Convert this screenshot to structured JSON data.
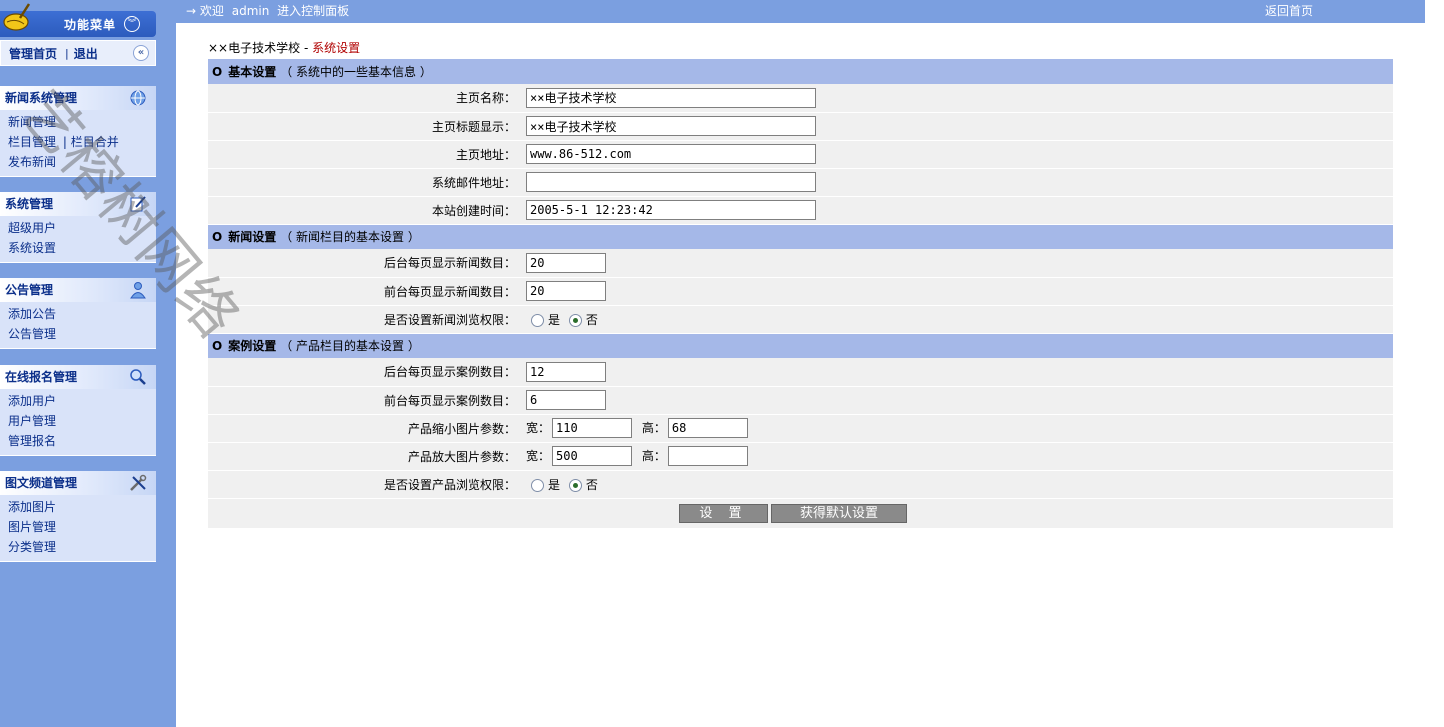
{
  "sidebar": {
    "menu_title": "功能菜单",
    "home_link": "管理首页",
    "separator": "|",
    "logout_link": "退出",
    "groups": [
      {
        "title": "新闻系统管理",
        "icon": "globe-icon",
        "items": [
          "新闻管理",
          "栏目管理",
          "发布新闻"
        ],
        "item2_extra": "栏目合并"
      },
      {
        "title": "系统管理",
        "icon": "edit-icon",
        "items": [
          "超级用户",
          "系统设置"
        ]
      },
      {
        "title": "公告管理",
        "icon": "user-icon",
        "items": [
          "添加公告",
          "公告管理"
        ]
      },
      {
        "title": "在线报名管理",
        "icon": "search-icon",
        "items": [
          "添加用户",
          "用户管理",
          "管理报名"
        ]
      },
      {
        "title": "图文频道管理",
        "icon": "tools-icon",
        "items": [
          "添加图片",
          "图片管理",
          "分类管理"
        ]
      }
    ]
  },
  "topbar": {
    "arrow": "→",
    "welcome": "欢迎",
    "user": "admin",
    "enter": "进入控制面板",
    "back_home": "返回首页"
  },
  "breadcrumb": {
    "site": "××电子技术学校",
    "sep": "-",
    "current": "系统设置"
  },
  "sections": {
    "basic": {
      "title": "基本设置",
      "desc": "（ 系统中的一些基本信息 ）"
    },
    "news": {
      "title": "新闻设置",
      "desc": "（ 新闻栏目的基本设置 ）"
    },
    "case": {
      "title": "案例设置",
      "desc": "（ 产品栏目的基本设置 ）"
    }
  },
  "fields": {
    "site_name": {
      "label": "主页名称：",
      "value": "××电子技术学校"
    },
    "site_title": {
      "label": "主页标题显示：",
      "value": "××电子技术学校"
    },
    "site_url": {
      "label": "主页地址：",
      "value": "www.86-512.com"
    },
    "email": {
      "label": "系统邮件地址：",
      "value": ""
    },
    "created": {
      "label": "本站创建时间：",
      "value": "2005-5-1 12:23:42"
    },
    "news_admin_per_page": {
      "label": "后台每页显示新闻数目：",
      "value": "20"
    },
    "news_front_per_page": {
      "label": "前台每页显示新闻数目：",
      "value": "20"
    },
    "news_perm": {
      "label": "是否设置新闻浏览权限：",
      "yes": "是",
      "no": "否",
      "selected": "否"
    },
    "case_admin_per_page": {
      "label": "后台每页显示案例数目：",
      "value": "12"
    },
    "case_front_per_page": {
      "label": "前台每页显示案例数目：",
      "value": "6"
    },
    "thumb": {
      "label": "产品缩小图片参数：",
      "w_label": "宽：",
      "w": "110",
      "h_label": "高：",
      "h": "68"
    },
    "large": {
      "label": "产品放大图片参数：",
      "w_label": "宽：",
      "w": "500",
      "h_label": "高：",
      "h": ""
    },
    "product_perm": {
      "label": "是否设置产品浏览权限：",
      "yes": "是",
      "no": "否",
      "selected": "否"
    }
  },
  "buttons": {
    "submit": "设 置",
    "defaults": "获得默认设置"
  },
  "watermark": "艺榕树网络"
}
